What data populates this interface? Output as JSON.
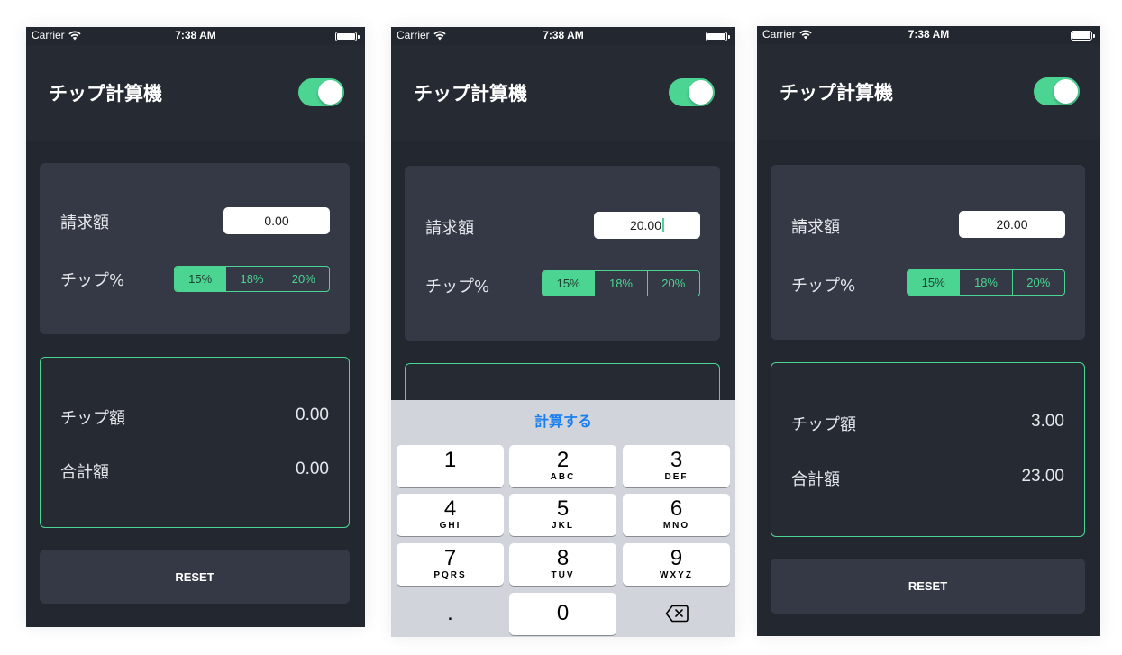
{
  "status_bar": {
    "carrier": "Carrier",
    "time": "7:38 AM",
    "wifi_icon": "wifi-icon",
    "battery_icon": "battery-icon"
  },
  "app": {
    "title": "チップ計算機",
    "accent_color": "#4cd493",
    "background_color": "#23272f"
  },
  "labels": {
    "bill": "請求額",
    "tip_percent": "チップ%",
    "tip_amount": "チップ額",
    "total": "合計額"
  },
  "segments": [
    "15%",
    "18%",
    "20%"
  ],
  "reset_label": "RESET",
  "screens": [
    {
      "bill_value": "0.00",
      "selected_segment": "15%",
      "tip_amount": "0.00",
      "total": "0.00"
    },
    {
      "bill_value": "20.00",
      "selected_segment": "15%"
    },
    {
      "bill_value": "20.00",
      "selected_segment": "15%",
      "tip_amount": "3.00",
      "total": "23.00"
    }
  ],
  "keyboard": {
    "accessory_label": "計算する",
    "keys": [
      {
        "num": "1",
        "letters": ""
      },
      {
        "num": "2",
        "letters": "ABC"
      },
      {
        "num": "3",
        "letters": "DEF"
      },
      {
        "num": "4",
        "letters": "GHI"
      },
      {
        "num": "5",
        "letters": "JKL"
      },
      {
        "num": "6",
        "letters": "MNO"
      },
      {
        "num": "7",
        "letters": "PQRS"
      },
      {
        "num": "8",
        "letters": "TUV"
      },
      {
        "num": "9",
        "letters": "WXYZ"
      }
    ],
    "decimal": ".",
    "zero": "0",
    "delete_icon": "backspace-icon"
  }
}
